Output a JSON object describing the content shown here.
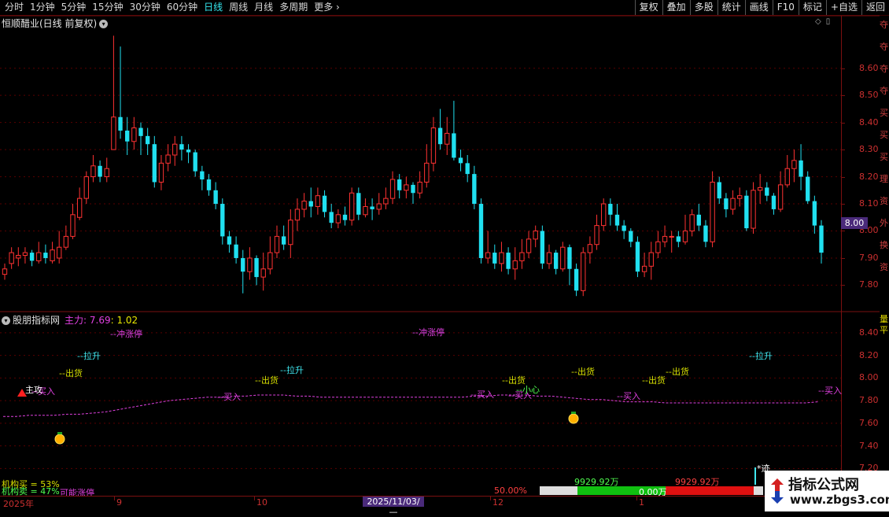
{
  "toolbar": {
    "periods": [
      "分时",
      "1分钟",
      "5分钟",
      "15分钟",
      "30分钟",
      "60分钟",
      "日线",
      "周线",
      "月线",
      "多周期",
      "更多"
    ],
    "active_period": "日线",
    "right_buttons": [
      "复权",
      "叠加",
      "多股",
      "统计",
      "画线",
      "F10",
      "标记",
      "+自选",
      "返回"
    ]
  },
  "main": {
    "title": "恒顺醋业(日线 前复权)",
    "current_price_label": "8.00",
    "axis_ticks": [
      "8.60",
      "8.50",
      "8.40",
      "8.30",
      "8.20",
      "8.10",
      "8.00",
      "7.90",
      "7.80"
    ]
  },
  "indicator": {
    "title": "股朋指标网",
    "main_label": "主力: 7.69",
    "ratio": ": 1.02",
    "axis_ticks": [
      "8.40",
      "8.20",
      "8.00",
      "7.80",
      "7.60",
      "7.40",
      "7.20"
    ],
    "signals": {
      "surge1": "--冲涨停",
      "surge2": "--冲涨停",
      "pull1": "--拉升",
      "pull2": "--拉升",
      "pull3": "--拉升",
      "ship1": "--出货",
      "ship2": "--出货",
      "ship3": "--出货",
      "ship4": "--出货",
      "ship5": "--出货",
      "ship6": "--出货",
      "buy1": "--买入",
      "buy2": "--买入",
      "buy3": "--买入",
      "buy4": "--买入",
      "buy5": "--买入",
      "buy6": "--买入",
      "careful": "--小心",
      "attack": "主攻",
      "trace": "*迹"
    },
    "inst_buy": "机构买 = 53%",
    "inst_sell": "机构卖 = 47%",
    "maybe_up": "可能涨停",
    "pct50": "50.00%",
    "vol_left": "9929.92万",
    "vol_right": "9929.92万",
    "bar_mid": "0.00万"
  },
  "side_strip": [
    "夺",
    "夺",
    "夺",
    "夺",
    "买",
    "买",
    "买",
    "理",
    "资",
    "外",
    "换",
    "资"
  ],
  "side_strip_bottom": [
    "量",
    "平"
  ],
  "date_axis": {
    "labels": [
      "2025年",
      "9",
      "10",
      "12",
      "1"
    ],
    "cursor": "2025/11/03/—"
  },
  "watermark": {
    "title": "指标公式网",
    "url": "www.zbgs3.com"
  },
  "colors": {
    "up": "#ff3232",
    "down": "#20e0f0",
    "grid": "#5a0000",
    "line_magenta": "#e040e0"
  },
  "chart_data": {
    "type": "candlestick",
    "price_range": [
      7.72,
      8.75
    ],
    "candles": [
      [
        7.84,
        7.86,
        7.88,
        7.82
      ],
      [
        7.88,
        7.92,
        7.94,
        7.86
      ],
      [
        7.9,
        7.91,
        7.94,
        7.87
      ],
      [
        7.91,
        7.92,
        7.94,
        7.88
      ],
      [
        7.92,
        7.89,
        7.93,
        7.87
      ],
      [
        7.89,
        7.92,
        7.96,
        7.88
      ],
      [
        7.92,
        7.9,
        7.95,
        7.88
      ],
      [
        7.89,
        7.93,
        7.96,
        7.88
      ],
      [
        7.9,
        7.94,
        8.0,
        7.88
      ],
      [
        7.94,
        7.98,
        8.02,
        7.93
      ],
      [
        7.98,
        8.06,
        8.1,
        7.97
      ],
      [
        8.05,
        8.12,
        8.16,
        8.04
      ],
      [
        8.12,
        8.2,
        8.22,
        8.1
      ],
      [
        8.2,
        8.24,
        8.28,
        8.18
      ],
      [
        8.24,
        8.2,
        8.26,
        8.18
      ],
      [
        8.2,
        8.23,
        8.27,
        8.18
      ],
      [
        8.3,
        8.42,
        8.72,
        8.3
      ],
      [
        8.42,
        8.37,
        8.68,
        8.34
      ],
      [
        8.37,
        8.33,
        8.42,
        8.28
      ],
      [
        8.33,
        8.38,
        8.42,
        8.3
      ],
      [
        8.38,
        8.35,
        8.4,
        8.28
      ],
      [
        8.35,
        8.32,
        8.38,
        8.28
      ],
      [
        8.32,
        8.18,
        8.35,
        8.16
      ],
      [
        8.18,
        8.25,
        8.28,
        8.15
      ],
      [
        8.25,
        8.28,
        8.32,
        8.22
      ],
      [
        8.28,
        8.32,
        8.35,
        8.24
      ],
      [
        8.32,
        8.3,
        8.35,
        8.26
      ],
      [
        8.3,
        8.29,
        8.32,
        8.25
      ],
      [
        8.29,
        8.22,
        8.3,
        8.2
      ],
      [
        8.22,
        8.19,
        8.24,
        8.15
      ],
      [
        8.19,
        8.15,
        8.21,
        8.13
      ],
      [
        8.15,
        8.1,
        8.18,
        8.08
      ],
      [
        8.1,
        7.98,
        8.12,
        7.95
      ],
      [
        7.98,
        7.95,
        8.0,
        7.92
      ],
      [
        7.95,
        7.9,
        7.98,
        7.88
      ],
      [
        7.9,
        7.85,
        7.93,
        7.77
      ],
      [
        7.85,
        7.9,
        7.94,
        7.82
      ],
      [
        7.9,
        7.83,
        7.91,
        7.8
      ],
      [
        7.83,
        7.86,
        7.92,
        7.78
      ],
      [
        7.86,
        7.92,
        7.98,
        7.84
      ],
      [
        7.92,
        7.98,
        8.02,
        7.9
      ],
      [
        7.98,
        7.95,
        8.02,
        7.93
      ],
      [
        7.95,
        8.04,
        8.08,
        7.9
      ],
      [
        8.04,
        8.08,
        8.12,
        8.0
      ],
      [
        8.08,
        8.11,
        8.14,
        8.05
      ],
      [
        8.11,
        8.09,
        8.16,
        8.05
      ],
      [
        8.09,
        8.13,
        8.16,
        8.06
      ],
      [
        8.13,
        8.07,
        8.15,
        8.05
      ],
      [
        8.07,
        8.03,
        8.1,
        8.01
      ],
      [
        8.03,
        8.06,
        8.08,
        8.01
      ],
      [
        8.06,
        8.04,
        8.09,
        8.02
      ],
      [
        8.04,
        8.14,
        8.16,
        8.02
      ],
      [
        8.14,
        8.06,
        8.16,
        8.04
      ],
      [
        8.06,
        8.09,
        8.12,
        8.05
      ],
      [
        8.09,
        8.08,
        8.12,
        8.04
      ],
      [
        8.08,
        8.1,
        8.14,
        8.06
      ],
      [
        8.1,
        8.12,
        8.16,
        8.08
      ],
      [
        8.12,
        8.19,
        8.22,
        8.1
      ],
      [
        8.19,
        8.15,
        8.21,
        8.12
      ],
      [
        8.15,
        8.17,
        8.2,
        8.12
      ],
      [
        8.17,
        8.14,
        8.18,
        8.1
      ],
      [
        8.14,
        8.18,
        8.22,
        8.12
      ],
      [
        8.18,
        8.25,
        8.32,
        8.16
      ],
      [
        8.25,
        8.38,
        8.42,
        8.22
      ],
      [
        8.38,
        8.32,
        8.45,
        8.3
      ],
      [
        8.32,
        8.36,
        8.42,
        8.28
      ],
      [
        8.36,
        8.27,
        8.48,
        8.26
      ],
      [
        8.27,
        8.25,
        8.3,
        8.22
      ],
      [
        8.25,
        8.21,
        8.28,
        8.18
      ],
      [
        8.21,
        8.1,
        8.24,
        8.08
      ],
      [
        8.1,
        7.9,
        8.12,
        7.88
      ],
      [
        7.9,
        7.92,
        8.0,
        7.88
      ],
      [
        7.92,
        7.88,
        7.95,
        7.86
      ],
      [
        7.88,
        7.92,
        7.96,
        7.85
      ],
      [
        7.92,
        7.86,
        7.94,
        7.84
      ],
      [
        7.86,
        7.89,
        7.94,
        7.82
      ],
      [
        7.89,
        7.92,
        7.97,
        7.86
      ],
      [
        7.92,
        7.97,
        8.0,
        7.9
      ],
      [
        7.97,
        8.0,
        8.02,
        7.94
      ],
      [
        8.0,
        7.88,
        8.02,
        7.86
      ],
      [
        7.88,
        7.92,
        7.95,
        7.86
      ],
      [
        7.92,
        7.86,
        7.93,
        7.84
      ],
      [
        7.86,
        7.94,
        7.96,
        7.85
      ],
      [
        7.94,
        7.86,
        7.95,
        7.8
      ],
      [
        7.86,
        7.78,
        7.88,
        7.76
      ],
      [
        7.78,
        7.92,
        7.94,
        7.76
      ],
      [
        7.92,
        7.95,
        7.98,
        7.88
      ],
      [
        7.95,
        8.02,
        8.06,
        7.93
      ],
      [
        8.02,
        8.1,
        8.12,
        8.0
      ],
      [
        8.1,
        8.06,
        8.12,
        8.02
      ],
      [
        8.06,
        8.02,
        8.1,
        8.0
      ],
      [
        8.02,
        8.0,
        8.04,
        7.97
      ],
      [
        8.0,
        7.96,
        8.01,
        7.94
      ],
      [
        7.96,
        7.85,
        7.98,
        7.83
      ],
      [
        7.85,
        7.87,
        7.92,
        7.83
      ],
      [
        7.87,
        7.92,
        7.96,
        7.82
      ],
      [
        7.92,
        7.96,
        8.0,
        7.9
      ],
      [
        7.96,
        7.98,
        8.02,
        7.94
      ],
      [
        7.98,
        7.98,
        8.0,
        7.92
      ],
      [
        7.98,
        7.96,
        8.0,
        7.94
      ],
      [
        7.96,
        8.0,
        8.06,
        7.95
      ],
      [
        8.0,
        8.06,
        8.08,
        7.98
      ],
      [
        8.06,
        8.02,
        8.1,
        8.0
      ],
      [
        8.02,
        7.96,
        8.04,
        7.94
      ],
      [
        7.96,
        8.18,
        8.22,
        7.94
      ],
      [
        8.18,
        8.12,
        8.2,
        8.1
      ],
      [
        8.12,
        8.08,
        8.14,
        8.05
      ],
      [
        8.08,
        8.12,
        8.15,
        8.06
      ],
      [
        8.12,
        8.13,
        8.16,
        8.09
      ],
      [
        8.13,
        8.01,
        8.15,
        8.0
      ],
      [
        8.01,
        8.15,
        8.18,
        7.99
      ],
      [
        8.15,
        8.16,
        8.21,
        8.1
      ],
      [
        8.16,
        8.13,
        8.18,
        8.11
      ],
      [
        8.13,
        8.08,
        8.14,
        8.06
      ],
      [
        8.08,
        8.17,
        8.22,
        8.07
      ],
      [
        8.17,
        8.23,
        8.28,
        8.16
      ],
      [
        8.23,
        8.26,
        8.3,
        8.18
      ],
      [
        8.26,
        8.2,
        8.32,
        8.15
      ],
      [
        8.2,
        8.11,
        8.22,
        8.1
      ],
      [
        8.11,
        8.02,
        8.13,
        7.99
      ],
      [
        8.02,
        7.92,
        8.04,
        7.88
      ]
    ],
    "indicator_line": {
      "name": "主力",
      "value_range": [
        7.14,
        8.49
      ],
      "values": [
        7.66,
        7.66,
        7.67,
        7.67,
        7.67,
        7.68,
        7.68,
        7.69,
        7.7,
        7.72,
        7.74,
        7.76,
        7.78,
        7.8,
        7.81,
        7.82,
        7.83,
        7.83,
        7.84,
        7.84,
        7.85,
        7.85,
        7.85,
        7.84,
        7.84,
        7.83,
        7.83,
        7.83,
        7.83,
        7.83,
        7.83,
        7.83,
        7.83,
        7.83,
        7.83,
        7.83,
        7.83,
        7.84,
        7.84,
        7.85,
        7.85,
        7.85,
        7.84,
        7.84,
        7.83,
        7.82,
        7.81,
        7.81,
        7.8,
        7.79,
        7.79,
        7.79,
        7.78,
        7.78,
        7.78,
        7.78,
        7.78,
        7.78,
        7.78,
        7.78,
        7.78,
        7.78,
        7.78,
        7.78,
        7.79
      ]
    }
  }
}
